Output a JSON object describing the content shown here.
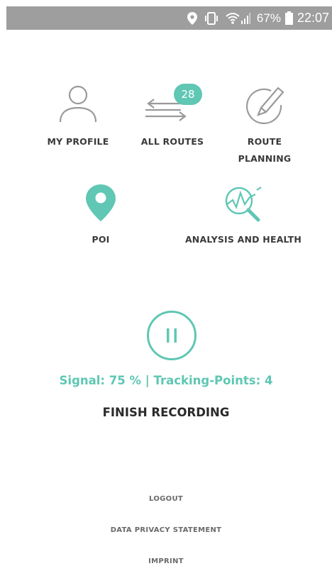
{
  "status_bar": {
    "battery": "67%",
    "time": "22:07",
    "icons": [
      "location-icon",
      "vibrate-icon",
      "wifi-icon",
      "signal-icon",
      "battery-icon"
    ]
  },
  "menu": {
    "profile_label": "MY PROFILE",
    "routes_label": "ALL ROUTES",
    "routes_badge": "28",
    "planning_label_line1": "ROUTE",
    "planning_label_line2": "PLANNING",
    "poi_label": "POI",
    "analysis_label": "ANALYSIS AND HEALTH"
  },
  "recording": {
    "status_text": "Signal: 75 % | Tracking-Points: 4",
    "finish_label": "FINISH RECORDING"
  },
  "footer": {
    "logout": "LOGOUT",
    "privacy": "DATA PRIVACY STATEMENT",
    "imprint": "IMPRINT"
  },
  "colors": {
    "accent": "#5fc7b4",
    "icon_gray": "#9a9a9a",
    "status_bar": "#9e9e9e"
  }
}
